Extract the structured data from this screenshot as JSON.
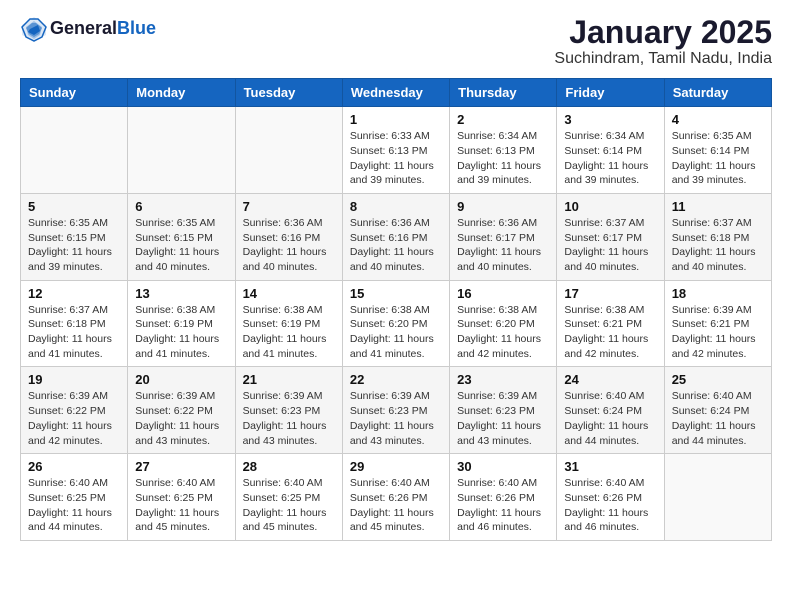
{
  "header": {
    "logo_line1": "General",
    "logo_line2": "Blue",
    "month": "January 2025",
    "location": "Suchindram, Tamil Nadu, India"
  },
  "weekdays": [
    "Sunday",
    "Monday",
    "Tuesday",
    "Wednesday",
    "Thursday",
    "Friday",
    "Saturday"
  ],
  "weeks": [
    [
      {
        "day": "",
        "info": ""
      },
      {
        "day": "",
        "info": ""
      },
      {
        "day": "",
        "info": ""
      },
      {
        "day": "1",
        "info": "Sunrise: 6:33 AM\nSunset: 6:13 PM\nDaylight: 11 hours and 39 minutes."
      },
      {
        "day": "2",
        "info": "Sunrise: 6:34 AM\nSunset: 6:13 PM\nDaylight: 11 hours and 39 minutes."
      },
      {
        "day": "3",
        "info": "Sunrise: 6:34 AM\nSunset: 6:14 PM\nDaylight: 11 hours and 39 minutes."
      },
      {
        "day": "4",
        "info": "Sunrise: 6:35 AM\nSunset: 6:14 PM\nDaylight: 11 hours and 39 minutes."
      }
    ],
    [
      {
        "day": "5",
        "info": "Sunrise: 6:35 AM\nSunset: 6:15 PM\nDaylight: 11 hours and 39 minutes."
      },
      {
        "day": "6",
        "info": "Sunrise: 6:35 AM\nSunset: 6:15 PM\nDaylight: 11 hours and 40 minutes."
      },
      {
        "day": "7",
        "info": "Sunrise: 6:36 AM\nSunset: 6:16 PM\nDaylight: 11 hours and 40 minutes."
      },
      {
        "day": "8",
        "info": "Sunrise: 6:36 AM\nSunset: 6:16 PM\nDaylight: 11 hours and 40 minutes."
      },
      {
        "day": "9",
        "info": "Sunrise: 6:36 AM\nSunset: 6:17 PM\nDaylight: 11 hours and 40 minutes."
      },
      {
        "day": "10",
        "info": "Sunrise: 6:37 AM\nSunset: 6:17 PM\nDaylight: 11 hours and 40 minutes."
      },
      {
        "day": "11",
        "info": "Sunrise: 6:37 AM\nSunset: 6:18 PM\nDaylight: 11 hours and 40 minutes."
      }
    ],
    [
      {
        "day": "12",
        "info": "Sunrise: 6:37 AM\nSunset: 6:18 PM\nDaylight: 11 hours and 41 minutes."
      },
      {
        "day": "13",
        "info": "Sunrise: 6:38 AM\nSunset: 6:19 PM\nDaylight: 11 hours and 41 minutes."
      },
      {
        "day": "14",
        "info": "Sunrise: 6:38 AM\nSunset: 6:19 PM\nDaylight: 11 hours and 41 minutes."
      },
      {
        "day": "15",
        "info": "Sunrise: 6:38 AM\nSunset: 6:20 PM\nDaylight: 11 hours and 41 minutes."
      },
      {
        "day": "16",
        "info": "Sunrise: 6:38 AM\nSunset: 6:20 PM\nDaylight: 11 hours and 42 minutes."
      },
      {
        "day": "17",
        "info": "Sunrise: 6:38 AM\nSunset: 6:21 PM\nDaylight: 11 hours and 42 minutes."
      },
      {
        "day": "18",
        "info": "Sunrise: 6:39 AM\nSunset: 6:21 PM\nDaylight: 11 hours and 42 minutes."
      }
    ],
    [
      {
        "day": "19",
        "info": "Sunrise: 6:39 AM\nSunset: 6:22 PM\nDaylight: 11 hours and 42 minutes."
      },
      {
        "day": "20",
        "info": "Sunrise: 6:39 AM\nSunset: 6:22 PM\nDaylight: 11 hours and 43 minutes."
      },
      {
        "day": "21",
        "info": "Sunrise: 6:39 AM\nSunset: 6:23 PM\nDaylight: 11 hours and 43 minutes."
      },
      {
        "day": "22",
        "info": "Sunrise: 6:39 AM\nSunset: 6:23 PM\nDaylight: 11 hours and 43 minutes."
      },
      {
        "day": "23",
        "info": "Sunrise: 6:39 AM\nSunset: 6:23 PM\nDaylight: 11 hours and 43 minutes."
      },
      {
        "day": "24",
        "info": "Sunrise: 6:40 AM\nSunset: 6:24 PM\nDaylight: 11 hours and 44 minutes."
      },
      {
        "day": "25",
        "info": "Sunrise: 6:40 AM\nSunset: 6:24 PM\nDaylight: 11 hours and 44 minutes."
      }
    ],
    [
      {
        "day": "26",
        "info": "Sunrise: 6:40 AM\nSunset: 6:25 PM\nDaylight: 11 hours and 44 minutes."
      },
      {
        "day": "27",
        "info": "Sunrise: 6:40 AM\nSunset: 6:25 PM\nDaylight: 11 hours and 45 minutes."
      },
      {
        "day": "28",
        "info": "Sunrise: 6:40 AM\nSunset: 6:25 PM\nDaylight: 11 hours and 45 minutes."
      },
      {
        "day": "29",
        "info": "Sunrise: 6:40 AM\nSunset: 6:26 PM\nDaylight: 11 hours and 45 minutes."
      },
      {
        "day": "30",
        "info": "Sunrise: 6:40 AM\nSunset: 6:26 PM\nDaylight: 11 hours and 46 minutes."
      },
      {
        "day": "31",
        "info": "Sunrise: 6:40 AM\nSunset: 6:26 PM\nDaylight: 11 hours and 46 minutes."
      },
      {
        "day": "",
        "info": ""
      }
    ]
  ]
}
